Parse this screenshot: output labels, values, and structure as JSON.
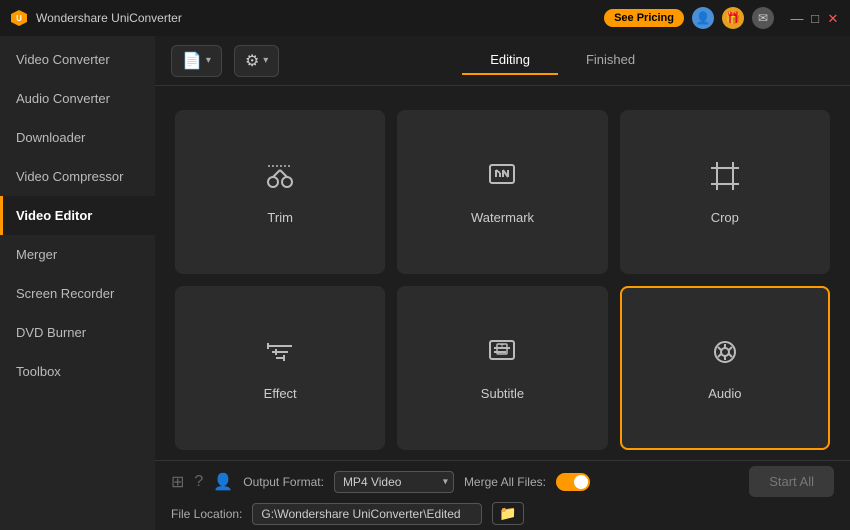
{
  "app": {
    "title": "Wondershare UniConverter",
    "logo": "U"
  },
  "titlebar": {
    "pricing_btn": "See Pricing",
    "window_controls": [
      "—",
      "□",
      "✕"
    ]
  },
  "sidebar": {
    "items": [
      {
        "id": "video-converter",
        "label": "Video Converter"
      },
      {
        "id": "audio-converter",
        "label": "Audio Converter"
      },
      {
        "id": "downloader",
        "label": "Downloader"
      },
      {
        "id": "video-compressor",
        "label": "Video Compressor"
      },
      {
        "id": "video-editor",
        "label": "Video Editor",
        "active": true
      },
      {
        "id": "merger",
        "label": "Merger"
      },
      {
        "id": "screen-recorder",
        "label": "Screen Recorder"
      },
      {
        "id": "dvd-burner",
        "label": "DVD Burner"
      },
      {
        "id": "toolbox",
        "label": "Toolbox"
      }
    ]
  },
  "tabs": [
    {
      "id": "editing",
      "label": "Editing",
      "active": true
    },
    {
      "id": "finished",
      "label": "Finished"
    }
  ],
  "grid": {
    "cards": [
      {
        "id": "trim",
        "label": "Trim",
        "icon": "trim"
      },
      {
        "id": "watermark",
        "label": "Watermark",
        "icon": "watermark"
      },
      {
        "id": "crop",
        "label": "Crop",
        "icon": "crop"
      },
      {
        "id": "effect",
        "label": "Effect",
        "icon": "effect"
      },
      {
        "id": "subtitle",
        "label": "Subtitle",
        "icon": "subtitle"
      },
      {
        "id": "audio",
        "label": "Audio",
        "icon": "audio",
        "selected": true
      }
    ]
  },
  "bottom": {
    "output_format_label": "Output Format:",
    "output_format_value": "MP4 Video",
    "merge_label": "Merge All Files:",
    "file_location_label": "File Location:",
    "file_location_value": "G:\\Wondershare UniConverter\\Edited",
    "start_all_btn": "Start All"
  },
  "footer_icons": [
    "layout",
    "help",
    "user-add"
  ]
}
